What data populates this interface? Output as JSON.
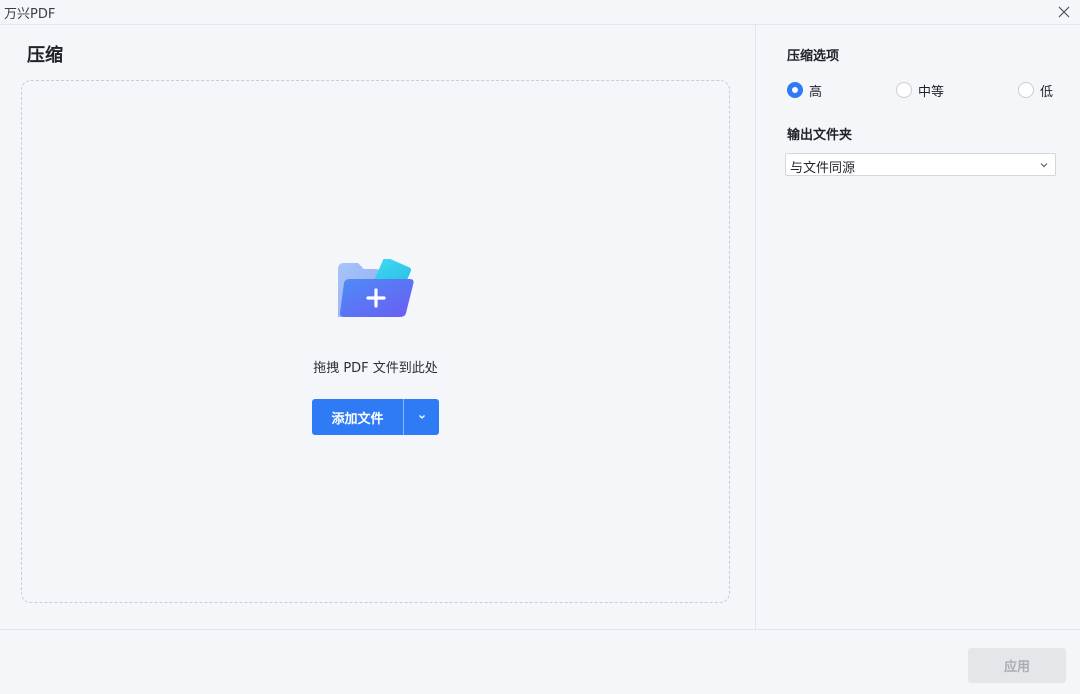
{
  "window": {
    "app_title": "万兴PDF"
  },
  "main": {
    "page_title": "压缩",
    "drop_text": "拖拽 PDF 文件到此处",
    "add_button_label": "添加文件"
  },
  "options": {
    "compression_label": "压缩选项",
    "levels": [
      {
        "label": "高",
        "selected": true
      },
      {
        "label": "中等",
        "selected": false
      },
      {
        "label": "低",
        "selected": false
      }
    ],
    "output_folder_label": "输出文件夹",
    "output_folder_value": "与文件同源"
  },
  "footer": {
    "apply_label": "应用"
  },
  "icons": {
    "close": "close-icon",
    "folder": "folder-add-icon",
    "dropdown": "chevron-down-icon"
  },
  "colors": {
    "accent": "#2f7bf5",
    "disabled_bg": "#e4e6ea",
    "disabled_text": "#a8adb6"
  }
}
